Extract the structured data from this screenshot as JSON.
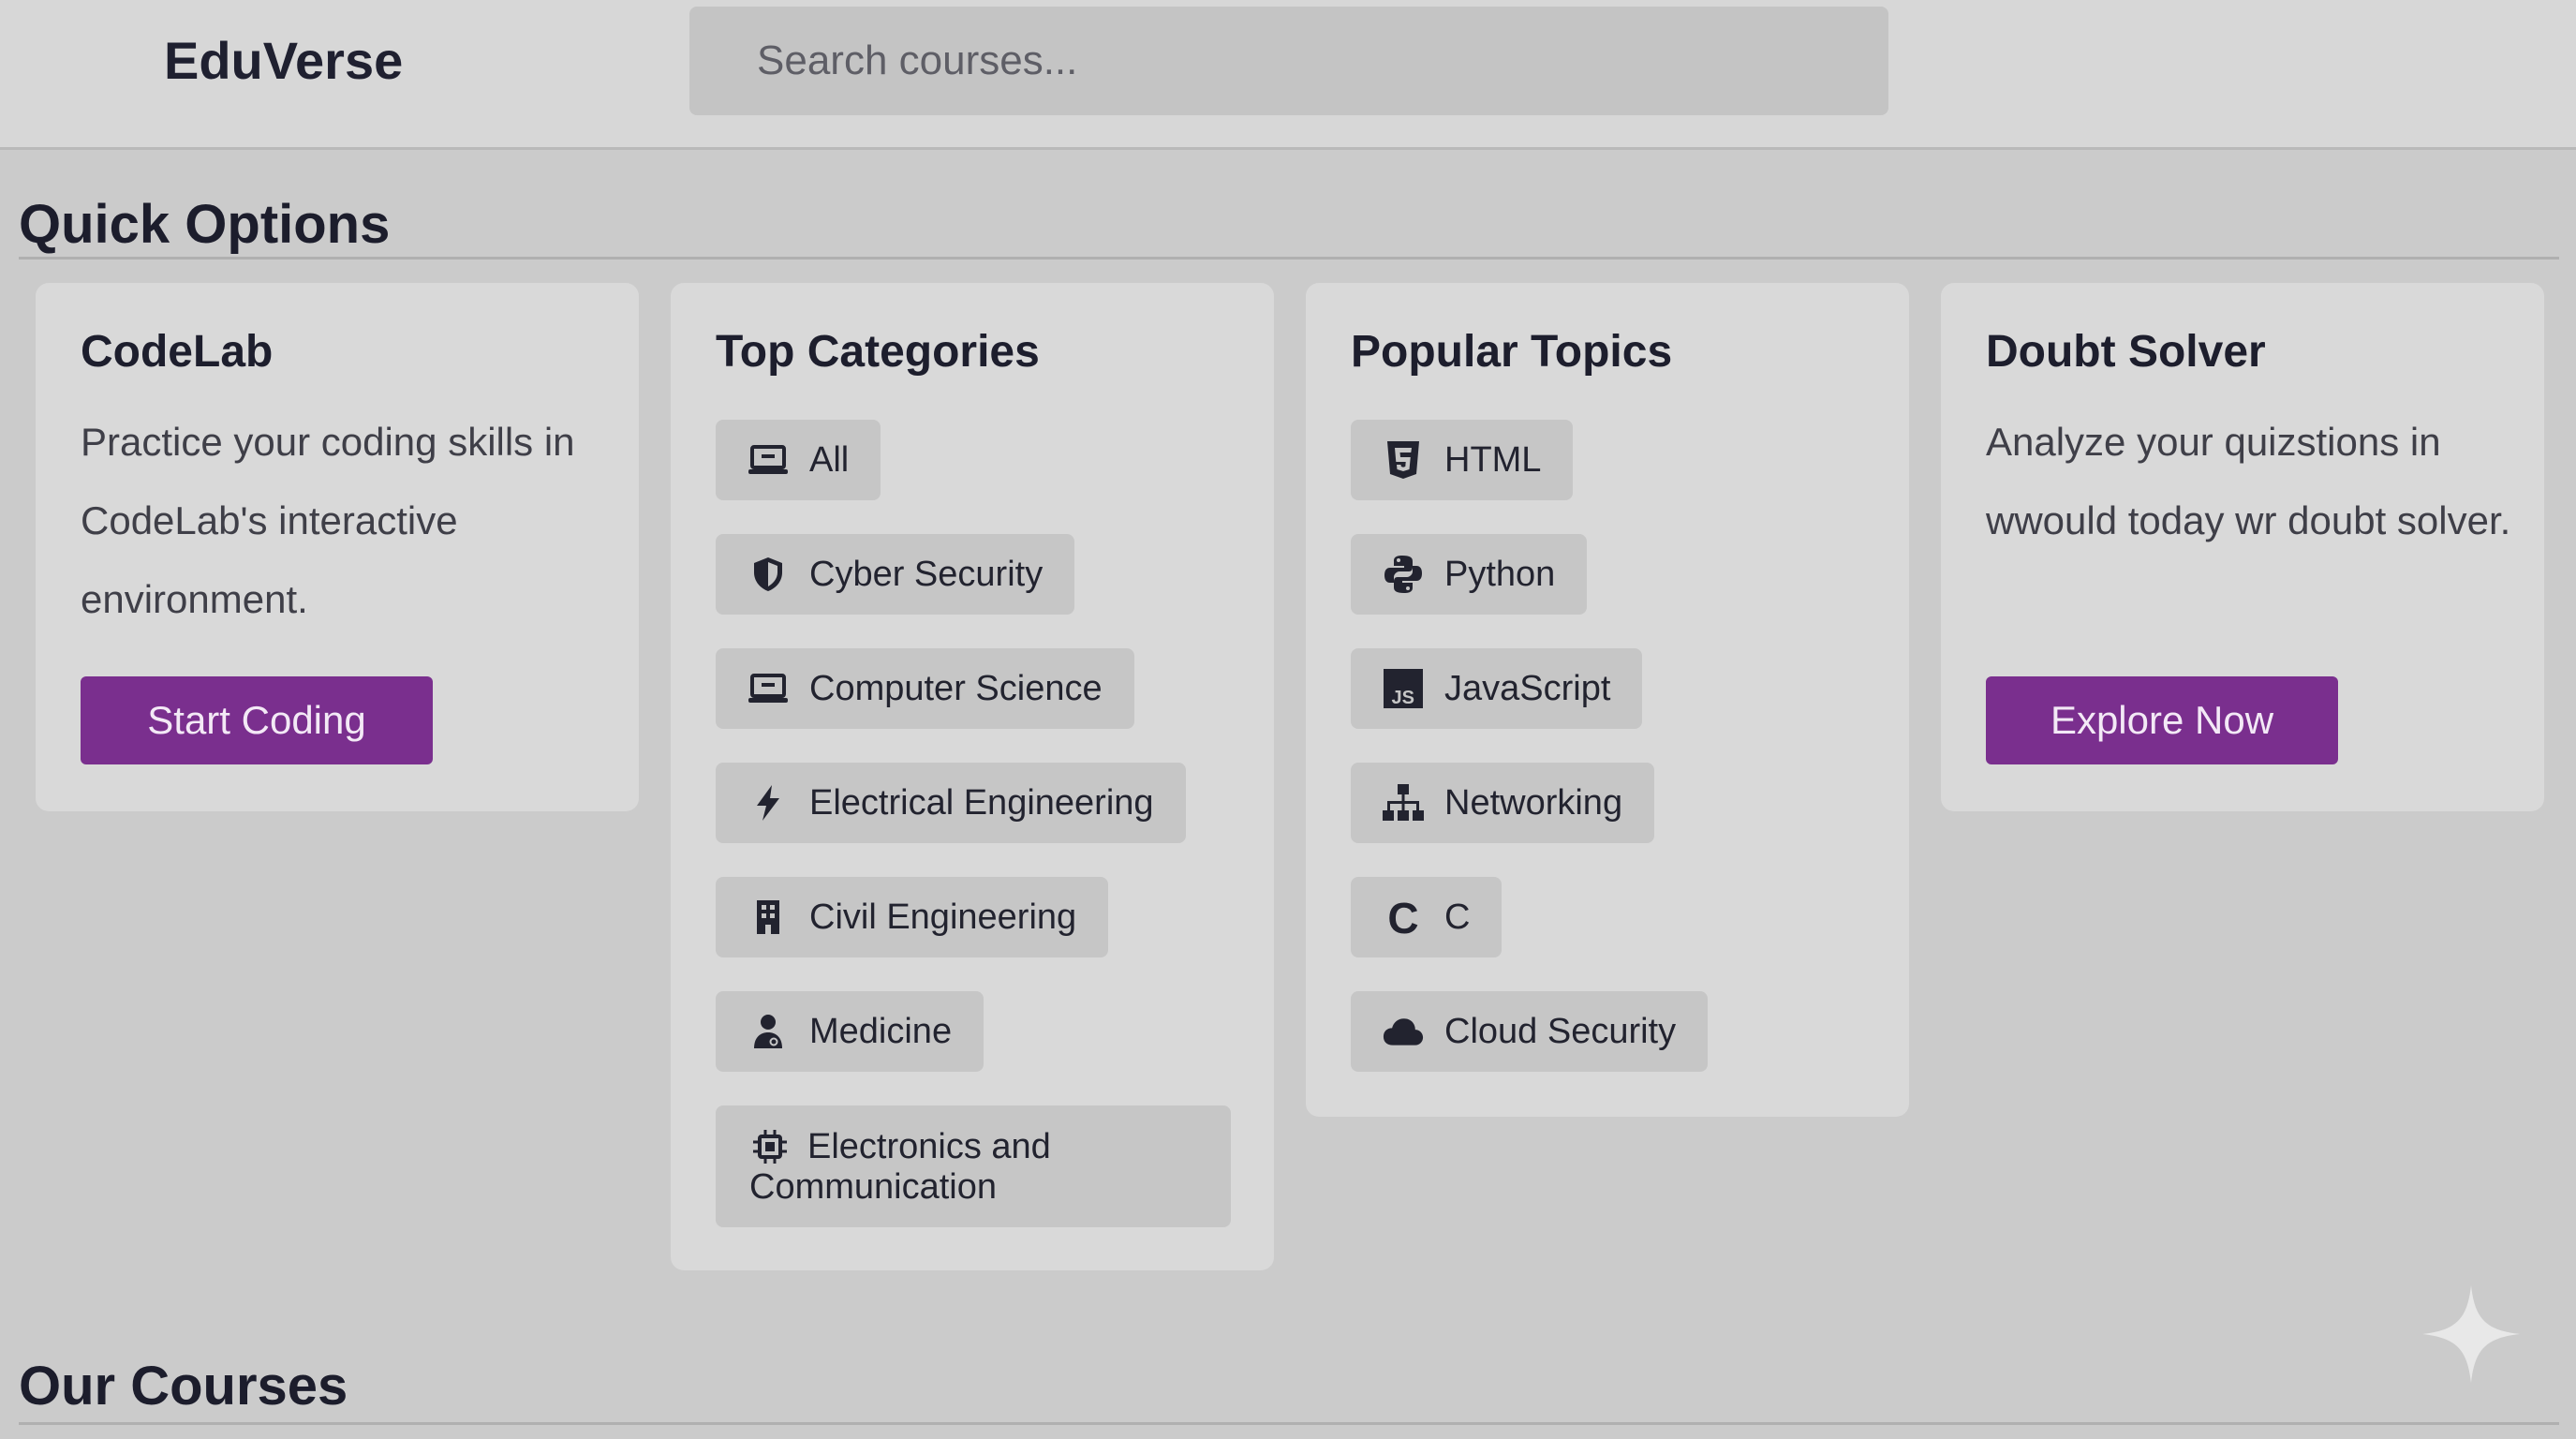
{
  "app": {
    "title": "EduVerse"
  },
  "search": {
    "placeholder": "Search courses..."
  },
  "quick_options": {
    "title": "Quick Options",
    "codelab": {
      "title": "CodeLab",
      "description": "Practice your coding skills in CodeLab's interactive environment.",
      "button_label": "Start Coding"
    },
    "top_categories": {
      "title": "Top Categories",
      "items": [
        {
          "label": "All",
          "icon": "laptop-icon"
        },
        {
          "label": "Cyber Security",
          "icon": "shield-icon"
        },
        {
          "label": "Computer Science",
          "icon": "laptop-icon"
        },
        {
          "label": "Electrical Engineering",
          "icon": "bolt-icon"
        },
        {
          "label": "Civil Engineering",
          "icon": "building-icon"
        },
        {
          "label": "Medicine",
          "icon": "doctor-icon"
        },
        {
          "label": "Electronics and",
          "label2": "Communication",
          "icon": "chip-icon"
        }
      ]
    },
    "popular_topics": {
      "title": "Popular Topics",
      "items": [
        {
          "label": "HTML",
          "icon": "html5-icon"
        },
        {
          "label": "Python",
          "icon": "python-icon"
        },
        {
          "label": "JavaScript",
          "icon": "javascript-icon"
        },
        {
          "label": "Networking",
          "icon": "network-icon"
        },
        {
          "label": "C",
          "icon": "c-language-icon"
        },
        {
          "label": "Cloud Security",
          "icon": "cloud-icon"
        }
      ]
    },
    "doubt_solver": {
      "title": "Doubt Solver",
      "description": "Analyze your quizstions in wwould today wr doubt solver.",
      "button_label": "Explore Now"
    }
  },
  "our_courses": {
    "title": "Our Courses"
  },
  "colors": {
    "accent": "#7a2f8e",
    "background": "#cbcbcb",
    "card": "#d9d9d9",
    "chip": "#c6c6c6",
    "text": "#1f1f2e"
  }
}
